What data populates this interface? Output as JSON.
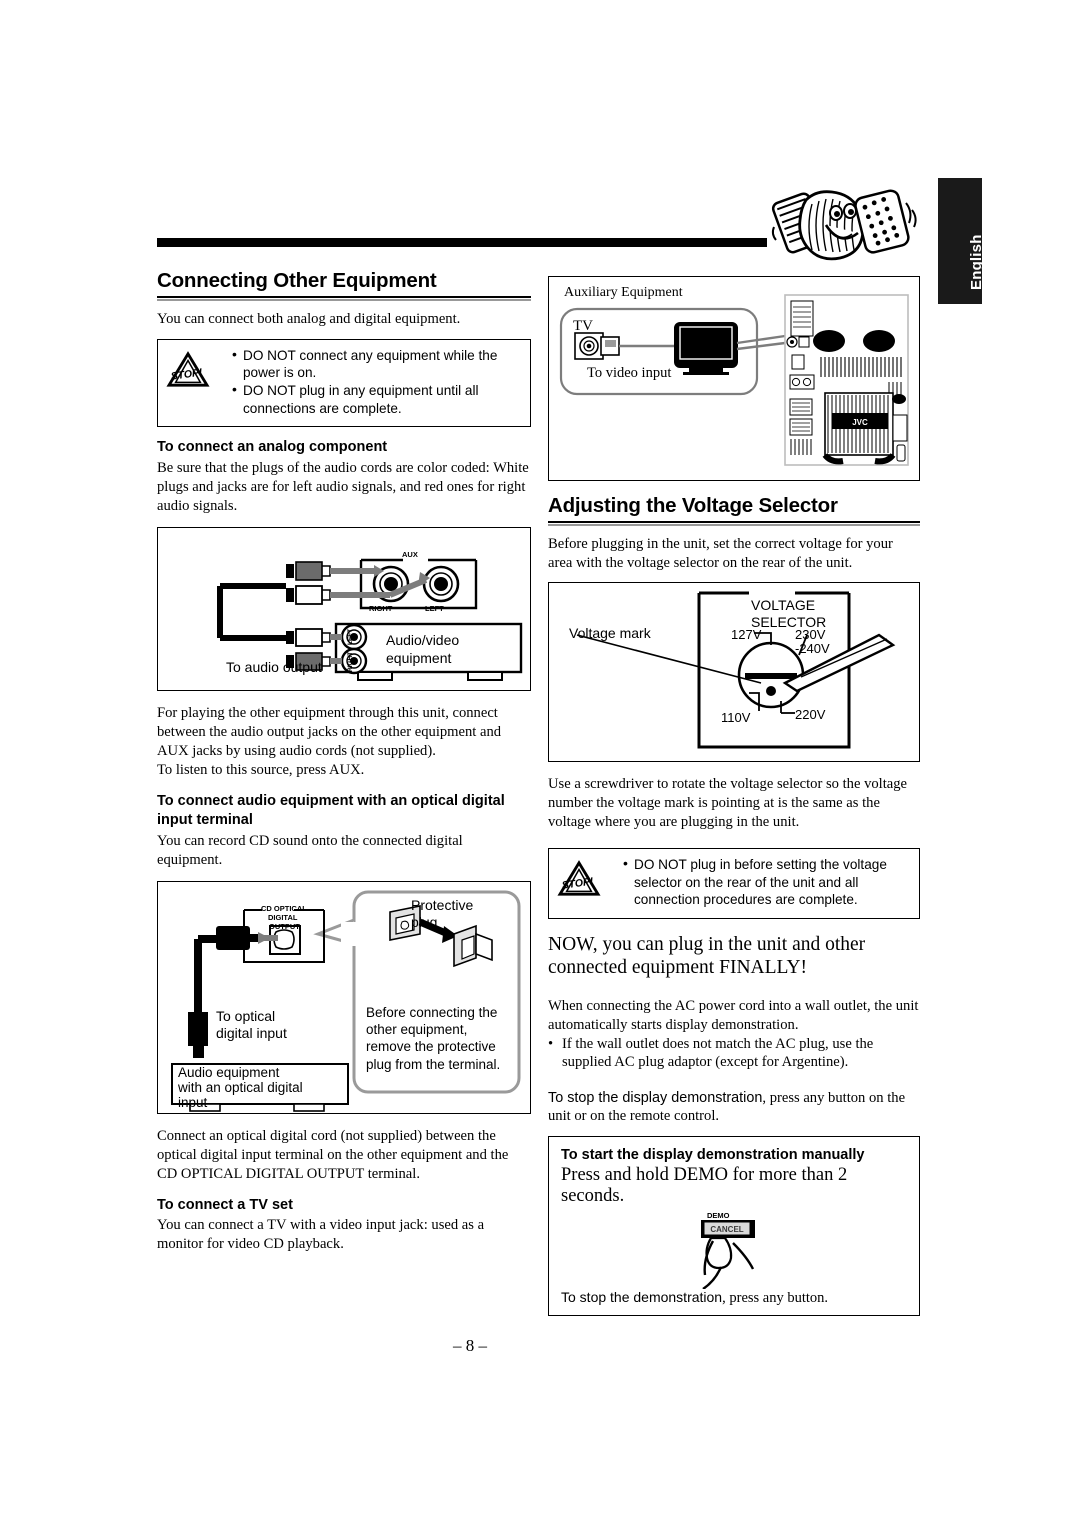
{
  "page": {
    "language_tab": "English",
    "page_number": "– 8 –"
  },
  "left_column": {
    "section_heading": "Connecting Other Equipment",
    "intro": "You can connect both analog and digital equipment.",
    "warning": {
      "icon_label": "STOP!",
      "items": [
        "DO NOT connect any equipment while the power is on.",
        "DO NOT plug in any equipment until all connections are complete."
      ]
    },
    "analog": {
      "heading": "To connect an analog component",
      "body": "Be sure that the plugs of the audio cords are color coded: White plugs and jacks are for left audio signals, and red ones for right audio signals.",
      "figure": {
        "aux_label": "AUX",
        "right_label": "RIGHT",
        "left_label": "LEFT",
        "jack_left": "LEFT",
        "jack_right": "RIGHT",
        "equipment_label_line1": "Audio/video",
        "equipment_label_line2": "equipment",
        "to_audio_output": "To audio output"
      },
      "after_figure": "For playing the other equipment through this unit, connect between the audio output jacks on the other equipment and AUX jacks by using audio cords (not supplied).",
      "after_figure_2": "To listen to this source, press AUX."
    },
    "optical": {
      "heading_line1": "To connect audio equipment with an optical digital",
      "heading_line2": "input terminal",
      "body": "You can record CD sound onto the connected digital equipment.",
      "figure": {
        "terminal_line1": "CD OPTICAL",
        "terminal_line2": "DIGITAL",
        "terminal_line3": "OUTPUT",
        "protective_plug_line1": "Protective",
        "protective_plug_line2": "plug",
        "to_optical_line1": "To optical",
        "to_optical_line2": "digital input",
        "audio_equipment_line1": "Audio equipment",
        "audio_equipment_line2": "with an optical digital",
        "audio_equipment_line3": "input",
        "before_connecting": "Before connecting the other equipment, remove the protective plug from the terminal."
      },
      "after_figure": "Connect an optical digital cord (not supplied) between the optical digital input terminal on the other equipment and the CD OPTICAL DIGITAL OUTPUT terminal."
    },
    "tv": {
      "heading": "To connect a TV set",
      "body": "You can connect a TV with a video input jack: used as a monitor for video CD playback."
    }
  },
  "right_column": {
    "aux_figure": {
      "title": "Auxiliary Equipment",
      "tv_label": "TV",
      "to_video_input": "To video input"
    },
    "voltage": {
      "section_heading": "Adjusting the Voltage Selector",
      "intro": "Before plugging in the unit, set the correct voltage for your area with the voltage selector on the rear of the unit.",
      "figure": {
        "title_line1": "VOLTAGE",
        "title_line2": "SELECTOR",
        "voltage_mark": "Voltage mark",
        "v127": "127V",
        "v230": "230V",
        "v240": "-240V",
        "v110": "110V",
        "v220": "220V"
      },
      "after_figure": "Use a screwdriver to rotate the voltage selector so the voltage number the voltage mark is pointing at is the same as the voltage where you are plugging in the unit.",
      "warning": {
        "icon_label": "STOP!",
        "items": [
          "DO NOT plug in before setting the voltage selector on the rear of the unit and all connection procedures are complete."
        ]
      }
    },
    "now": {
      "headline": "NOW, you can plug in the unit and other connected equipment FINALLY!",
      "body_line1": "When connecting the AC power cord into a wall outlet, the unit automatically starts display demonstration.",
      "bullet": "If the wall outlet does not match the AC plug, use the supplied AC plug adaptor (except for Argentine).",
      "stop_demo_bold": "To stop the display demonstration",
      "stop_demo_rest": ", press any button on the unit or on the remote control."
    },
    "demo_box": {
      "heading": "To start the display demonstration manually",
      "instruction": "Press and hold DEMO for more than 2 seconds.",
      "button_top_label": "DEMO",
      "button_label": "CANCEL",
      "stop_bold": "To stop the demonstration",
      "stop_rest": ", press any button."
    }
  }
}
